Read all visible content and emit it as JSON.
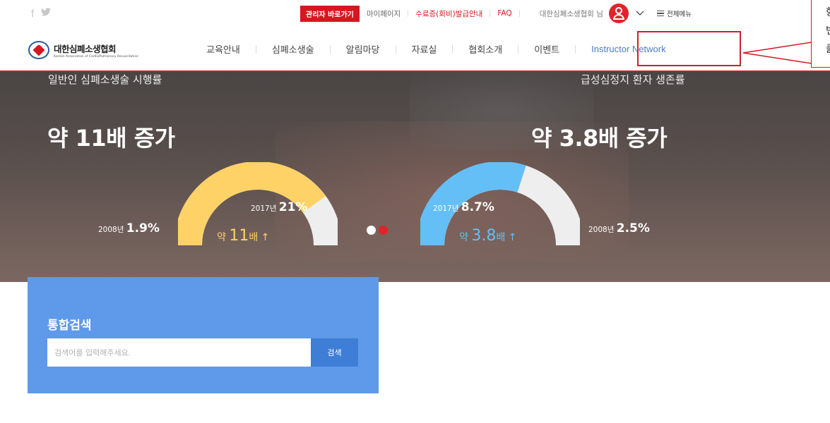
{
  "topbar": {
    "social": [
      "f",
      "🐦"
    ],
    "admin_label": "관리자 바로가기",
    "links": [
      "마이페이지",
      "수료증(회비)발급안내",
      "FAQ"
    ],
    "username": "대한심폐소생협회 님",
    "all_menu": "전체메뉴"
  },
  "logo": {
    "name_ko": "대한심폐소생협회",
    "name_en": "Korean Association of CardioPulmonary Resuscitation"
  },
  "nav": {
    "items": [
      "교육안내",
      "심폐소생술",
      "알림마당",
      "자료실",
      "협회소개",
      "이벤트"
    ],
    "instructor": "Instructor Network"
  },
  "callout": {
    "lines": [
      "항",
      "번",
      "클"
    ]
  },
  "hero": {
    "left": {
      "label": "일반인 심폐소생술 시행률",
      "headline": "약 11배 증가",
      "year_new": "2017년",
      "value_new": "21%",
      "year_old": "2008년",
      "value_old": "1.9%",
      "caption_pre": "약",
      "caption_num": "11",
      "caption_post": "배 ↑",
      "fill_fraction": 0.8,
      "color": "#ffd267"
    },
    "right": {
      "label": "급성심정지 환자 생존률",
      "headline": "약 3.8배 증가",
      "year_new": "2017년",
      "value_new": "8.7%",
      "year_old": "2008년",
      "value_old": "2.5%",
      "caption_pre": "약",
      "caption_num": "3.8",
      "caption_post": "배 ↑",
      "fill_fraction": 0.6,
      "color": "#64bff6"
    },
    "dots": [
      "#ffffff",
      "#e0242c"
    ]
  },
  "search": {
    "title": "통합검색",
    "placeholder": "검색어를 입력해주세요.",
    "button": "검색"
  },
  "colors": {
    "accent_red": "#d7171f",
    "search_blue": "#5e99ea",
    "nav_blue": "#4a7cc7"
  }
}
